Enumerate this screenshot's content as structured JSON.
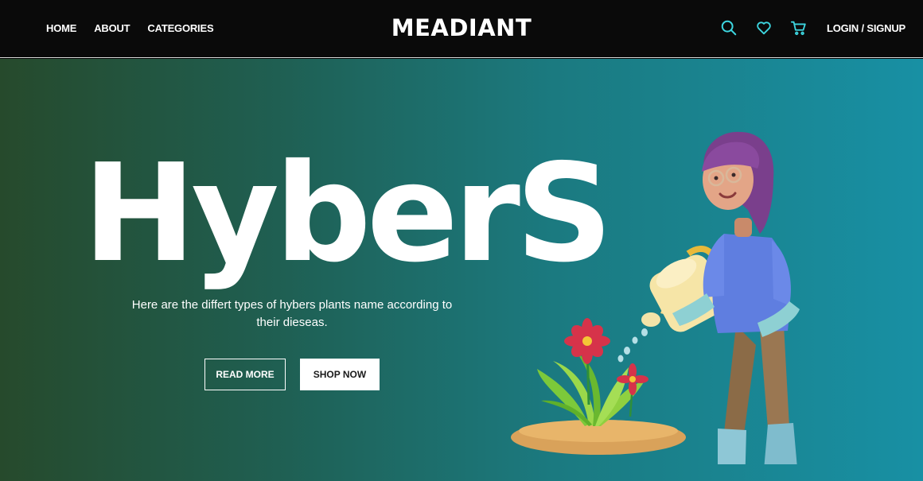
{
  "nav": {
    "links": [
      "HOME",
      "ABOUT",
      "CATEGORIES"
    ],
    "brand": "MEADIANT",
    "login": "LOGIN / SIGNUP",
    "icon_color": "#3dd6e0",
    "icons": [
      "search-icon",
      "heart-icon",
      "cart-icon"
    ]
  },
  "hero": {
    "title": "HyberS",
    "description": "Here are the differt types of hybers plants name according to their dieseas.",
    "read_more": "READ MORE",
    "shop_now": "SHOP NOW",
    "gradient": [
      "#264a2c",
      "#1890a4"
    ]
  }
}
